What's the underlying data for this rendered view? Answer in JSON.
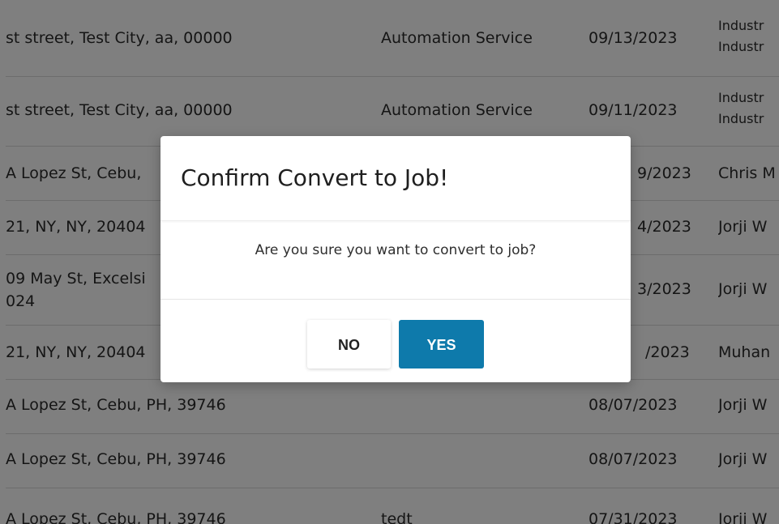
{
  "table": {
    "rows": [
      {
        "address": "st street, Test City, aa, 00000",
        "service": "Automation Service",
        "date": "09/13/2023",
        "name": "Industr",
        "name2": "Industr"
      },
      {
        "address": "st street, Test City, aa, 00000",
        "service": "Automation Service",
        "date": "09/11/2023",
        "name": "Industr",
        "name2": "Industr"
      },
      {
        "address": "A Lopez St, Cebu,",
        "service": "",
        "date": "9/2023",
        "name": "Chris M"
      },
      {
        "address": "21, NY, NY, 20404",
        "service": "",
        "date": "4/2023",
        "name": "Jorji W"
      },
      {
        "address": "09 May St, Excelsi",
        "address2": "024",
        "service": "",
        "date": "3/2023",
        "name": "Jorji W"
      },
      {
        "address": "21, NY, NY, 20404",
        "service": "",
        "date": "/2023",
        "name": "Muhan"
      },
      {
        "address": "A Lopez St, Cebu, PH, 39746",
        "service": "",
        "date": "08/07/2023",
        "name": "Jorji W"
      },
      {
        "address": "A Lopez St, Cebu, PH, 39746",
        "service": "",
        "date": "08/07/2023",
        "name": "Jorji W"
      },
      {
        "address": "A Lopez St, Cebu, PH, 39746",
        "service": "tedt",
        "date": "07/31/2023",
        "name": "Jorji W"
      }
    ]
  },
  "modal": {
    "title": "Confirm Convert to Job!",
    "message": "Are you sure you want to convert to job?",
    "no_label": "NO",
    "yes_label": "YES"
  },
  "colors": {
    "overlay": "#000000",
    "primary": "#0e7aab"
  }
}
